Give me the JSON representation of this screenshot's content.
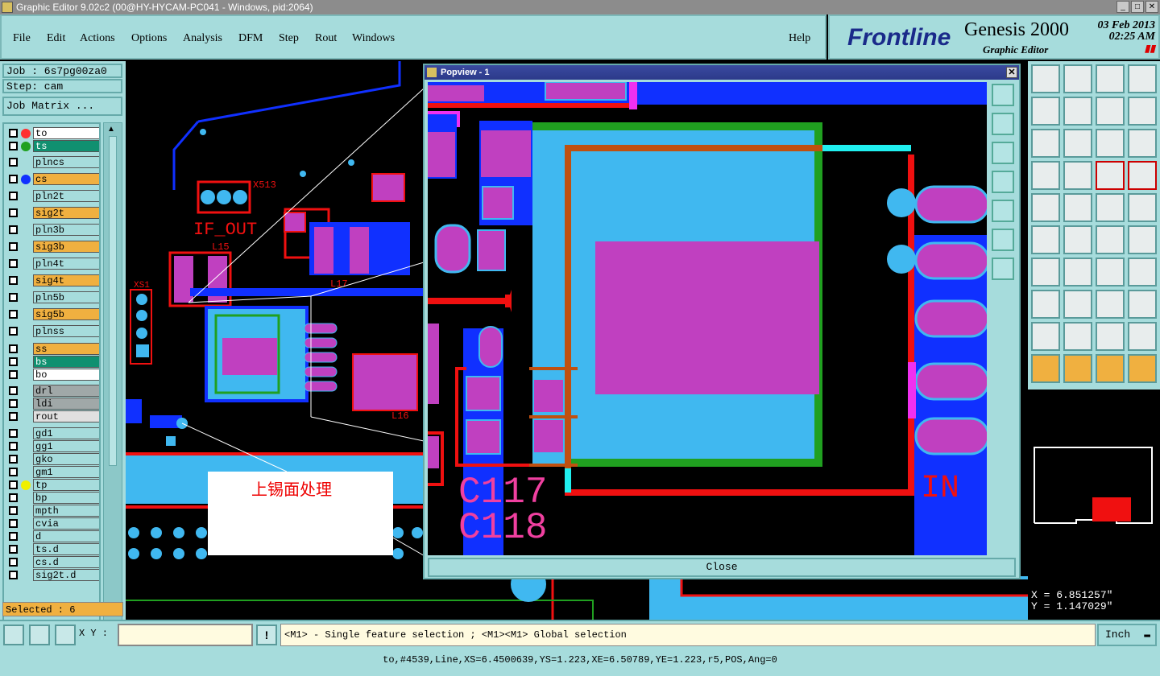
{
  "window": {
    "title": "Graphic Editor 9.02c2 (00@HY-HYCAM-PC041 - Windows, pid:2064)"
  },
  "menu": [
    "File",
    "Edit",
    "Actions",
    "Options",
    "Analysis",
    "DFM",
    "Step",
    "Rout",
    "Windows"
  ],
  "help": "Help",
  "brand": {
    "logo": "Frontline",
    "product": "Genesis 2000",
    "subtitle": "Graphic Editor",
    "date": "03 Feb 2013",
    "time": "02:25 AM"
  },
  "job": {
    "job_label": "Job : 6s7pg00za0",
    "step_label": "Step: cam",
    "matrix_button": "Job Matrix ..."
  },
  "layers": [
    {
      "name": "to",
      "color": "#ffffff",
      "dot": "#ff3030"
    },
    {
      "name": "ts",
      "color": "#109070",
      "dot": "#20a020"
    },
    {
      "name": "plncs",
      "color": "#a6dcdc"
    },
    {
      "name": "cs",
      "color": "#f0b040",
      "dot": "#1030ff"
    },
    {
      "name": "pln2t",
      "color": "#a6dcdc"
    },
    {
      "name": "sig2t",
      "color": "#f0b040"
    },
    {
      "name": "pln3b",
      "color": "#a6dcdc"
    },
    {
      "name": "sig3b",
      "color": "#f0b040"
    },
    {
      "name": "pln4t",
      "color": "#a6dcdc"
    },
    {
      "name": "sig4t",
      "color": "#f0b040"
    },
    {
      "name": "pln5b",
      "color": "#a6dcdc"
    },
    {
      "name": "sig5b",
      "color": "#f0b040"
    },
    {
      "name": "plnss",
      "color": "#a6dcdc"
    },
    {
      "name": "ss",
      "color": "#f0b040"
    },
    {
      "name": "bs",
      "color": "#109070"
    },
    {
      "name": "bo",
      "color": "#ffffff"
    },
    {
      "name": "drl",
      "color": "#a0a8a8"
    },
    {
      "name": "ldi",
      "color": "#a0a8a8"
    },
    {
      "name": "rout",
      "color": "#e0e0e0"
    },
    {
      "name": "gd1",
      "color": "#a6dcdc"
    },
    {
      "name": "gg1",
      "color": "#a6dcdc"
    },
    {
      "name": "gko",
      "color": "#a6dcdc"
    },
    {
      "name": "gm1",
      "color": "#a6dcdc"
    },
    {
      "name": "tp",
      "color": "#a6dcdc",
      "dot": "#f0f000"
    },
    {
      "name": "bp",
      "color": "#a6dcdc"
    },
    {
      "name": "mpth",
      "color": "#a6dcdc"
    },
    {
      "name": "cvia",
      "color": "#a6dcdc"
    },
    {
      "name": "d",
      "color": "#a6dcdc"
    },
    {
      "name": "ts.d",
      "color": "#a6dcdc"
    },
    {
      "name": "cs.d",
      "color": "#a6dcdc"
    },
    {
      "name": "sig2t.d",
      "color": "#a6dcdc"
    }
  ],
  "selected": "Selected : 6",
  "popview": {
    "title": "Popview - 1",
    "close_label": "Close",
    "close_x": "✕"
  },
  "pcb_labels": {
    "if_out": "IF_OUT",
    "x513": "X513",
    "l15": "L15",
    "l17": "L17",
    "xs1": "XS1",
    "c117": "C117",
    "c118": "C118",
    "in": "IN",
    "l16": "L16"
  },
  "note": "上锡面处理",
  "coords": {
    "x": "X = 6.851257\"",
    "y": "Y = 1.147029\""
  },
  "bottom": {
    "xy_label": "X Y :",
    "xy_value": "",
    "hint": "<M1> - Single feature selection ; <M1><M1> Global selection",
    "unit": "Inch",
    "status": "to,#4539,Line,XS=6.4500639,YS=1.223,XE=6.50789,YE=1.223,r5,POS,Ang=0"
  }
}
